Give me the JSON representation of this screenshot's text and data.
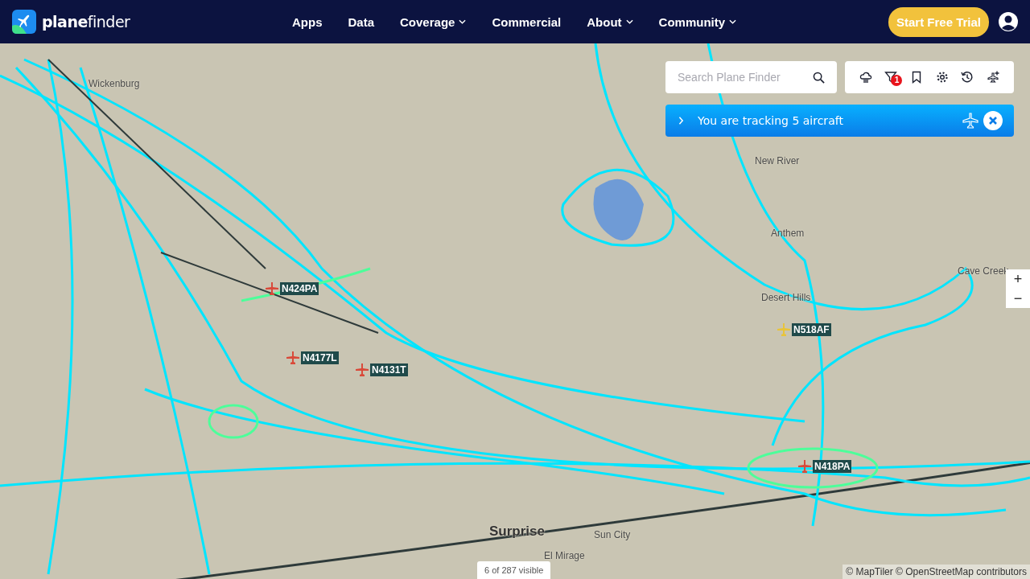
{
  "header": {
    "logo": {
      "part_1": "plane",
      "part_2": "finder"
    },
    "nav": [
      {
        "label": "Apps",
        "dropdown": false
      },
      {
        "label": "Data",
        "dropdown": false
      },
      {
        "label": "Coverage",
        "dropdown": true
      },
      {
        "label": "Commercial",
        "dropdown": false
      },
      {
        "label": "About",
        "dropdown": true
      },
      {
        "label": "Community",
        "dropdown": true
      }
    ],
    "trial_button": "Start Free Trial"
  },
  "search": {
    "placeholder": "Search Plane Finder"
  },
  "toolbar": {
    "filter_badge": "1"
  },
  "tracking_banner": {
    "text": "You are tracking 5 aircraft"
  },
  "zoom": {
    "in": "+",
    "out": "−"
  },
  "map": {
    "places": [
      {
        "name": "Wickenburg",
        "kind": "town"
      },
      {
        "name": "New River",
        "kind": "town"
      },
      {
        "name": "Anthem",
        "kind": "town"
      },
      {
        "name": "Desert Hills",
        "kind": "town"
      },
      {
        "name": "Cave Creek",
        "kind": "town"
      },
      {
        "name": "Surprise",
        "kind": "city"
      },
      {
        "name": "Sun City",
        "kind": "town"
      },
      {
        "name": "El Mirage",
        "kind": "town"
      }
    ],
    "aircraft": [
      {
        "callsign": "N424PA",
        "color": "#d94a3a"
      },
      {
        "callsign": "N4177L",
        "color": "#d94a3a"
      },
      {
        "callsign": "N4131T",
        "color": "#d94a3a"
      },
      {
        "callsign": "N518AF",
        "color": "#e8c43a"
      },
      {
        "callsign": "N418PA",
        "color": "#d94a3a"
      }
    ]
  },
  "visible_count": "6 of 287 visible",
  "attribution": "© MapTiler © OpenStreetMap contributors"
}
